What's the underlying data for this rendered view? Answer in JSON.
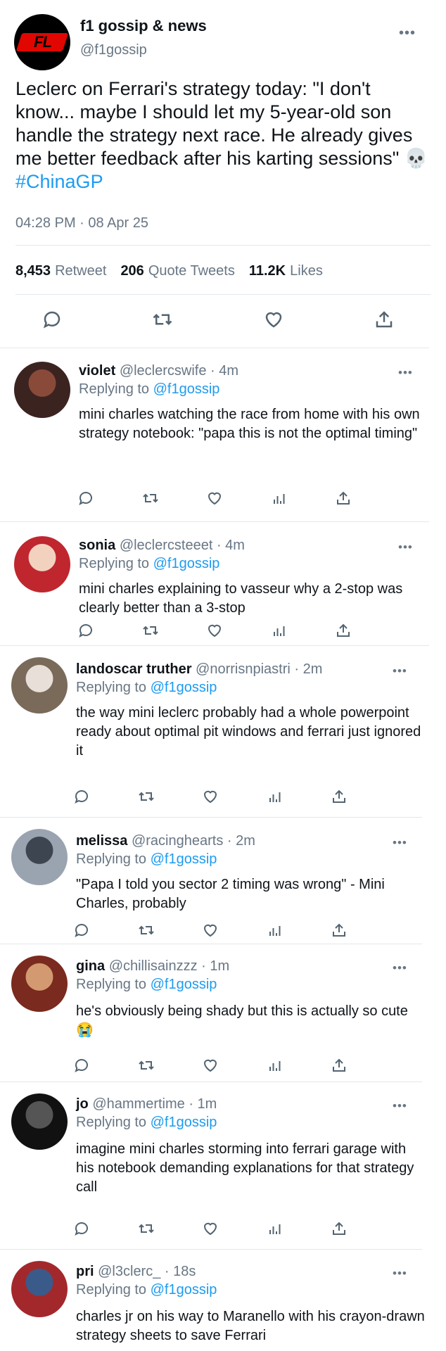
{
  "main": {
    "avatar_logo": "FL",
    "name": "f1 gossip & news",
    "handle": "@f1gossip",
    "more_icon": "more-dots-icon",
    "text": "Leclerc on Ferrari's strategy today: \"I don't know... maybe I should let my 5-year-old son handle the strategy next race. He already gives me better feedback after his karting sessions\" 💀 ",
    "hashtag": "#ChinaGP",
    "timestamp": "04:28 PM · 08 Apr 25",
    "stats": {
      "retweets": "8,453",
      "retweets_label": "Retweet",
      "quotes": "206",
      "quotes_label": "Quote Tweets",
      "likes": "11.2K",
      "likes_label": "Likes"
    },
    "icons": [
      "reply-icon",
      "retweet-icon",
      "like-icon",
      "share-icon"
    ]
  },
  "replies": [
    {
      "name": "violet",
      "handle": "@leclercswife · 4m",
      "replying": "Replying to ",
      "mention": "@f1gossip",
      "text": "mini charles watching the race from home with his own strategy notebook: \"papa this is not the optimal timing\""
    },
    {
      "name": "sonia",
      "handle": "@leclercsteeet · 4m",
      "replying": "Replying to ",
      "mention": "@f1gossip",
      "text": "mini charles explaining to vasseur why a 2-stop was clearly better than a 3-stop"
    },
    {
      "name": "landoscar truther",
      "handle": "@norrisnpiastri · 2m",
      "replying": "Replying to ",
      "mention": "@f1gossip",
      "text": "the way mini leclerc probably had a whole powerpoint ready about optimal pit windows and ferrari just ignored it"
    },
    {
      "name": "melissa",
      "handle": "@racinghearts · 2m",
      "replying": "Replying to ",
      "mention": "@f1gossip",
      "text": "\"Papa I told you sector 2 timing was wrong\" - Mini Charles, probably"
    },
    {
      "name": "gina",
      "handle": "@chillisainzzz · 1m",
      "replying": "Replying to ",
      "mention": "@f1gossip",
      "text": "he's obviously being shady but this is actually so cute 😭"
    },
    {
      "name": "jo",
      "handle": "@hammertime · 1m",
      "replying": "Replying to ",
      "mention": "@f1gossip",
      "text": "imagine mini charles storming into ferrari garage with his notebook demanding explanations for that strategy call"
    },
    {
      "name": "pri",
      "handle": "@l3clerc_ · 18s",
      "replying": "Replying to ",
      "mention": "@f1gossip",
      "text": "charles jr on his way to Maranello with his crayon-drawn strategy sheets to save Ferrari"
    }
  ],
  "reply_icons": [
    "reply-icon",
    "retweet-icon",
    "like-icon",
    "analytics-icon",
    "share-icon"
  ],
  "more_text": "•••",
  "colors": {
    "accent": "#1d9bf0",
    "muted": "#687684",
    "divider": "#e1e8ed"
  }
}
